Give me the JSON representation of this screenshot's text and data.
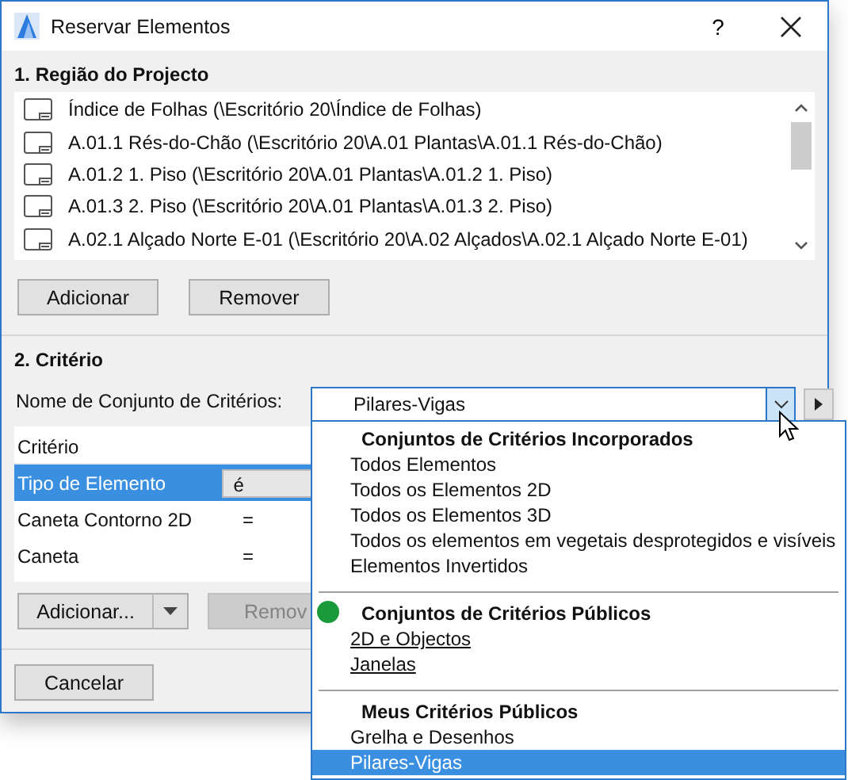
{
  "window": {
    "title": "Reservar Elementos",
    "help": "?"
  },
  "region": {
    "heading": "1. Região do Projecto",
    "items": [
      {
        "label": "Índice de Folhas (\\Escritório 20\\Índice de Folhas)"
      },
      {
        "label": "A.01.1 Rés-do-Chão (\\Escritório 20\\A.01 Plantas\\A.01.1 Rés-do-Chão)"
      },
      {
        "label": "A.01.2 1. Piso (\\Escritório 20\\A.01 Plantas\\A.01.2 1. Piso)"
      },
      {
        "label": "A.01.3 2. Piso (\\Escritório 20\\A.01 Plantas\\A.01.3 2. Piso)"
      },
      {
        "label": "A.02.1 Alçado Norte E-01 (\\Escritório 20\\A.02 Alçados\\A.02.1 Alçado Norte E-01)"
      }
    ],
    "buttons": [
      "Adicionar",
      "Remover"
    ]
  },
  "criteria": {
    "heading": "2. Critério",
    "set_label": "Nome de Conjunto de Critérios:",
    "set_value": "Pilares-Vigas",
    "column": "Critério",
    "rows": [
      {
        "name": "Tipo de Elemento",
        "operator": "é",
        "selected": true,
        "kind": "dropdown"
      },
      {
        "name": "Caneta Contorno 2D",
        "operator": "=",
        "selected": false,
        "kind": "plain"
      },
      {
        "name": "Caneta",
        "operator": "=",
        "selected": false,
        "kind": "plain"
      }
    ],
    "add_button": "Adicionar...",
    "remove_button": {
      "label": "Remov",
      "disabled": true
    }
  },
  "cancel_button": "Cancelar",
  "dropdown": {
    "groups": [
      {
        "title": "Conjuntos de Critérios Incorporados",
        "items": [
          {
            "label": "Todos Elementos",
            "underlined": false,
            "selected": false
          },
          {
            "label": "Todos os Elementos 2D",
            "underlined": false,
            "selected": false
          },
          {
            "label": "Todos os Elementos 3D",
            "underlined": false,
            "selected": false
          },
          {
            "label": "Todos os elementos em vegetais desprotegidos e visíveis",
            "underlined": false,
            "selected": false
          },
          {
            "label": "Elementos Invertidos",
            "underlined": false,
            "selected": false
          }
        ]
      },
      {
        "title": "Conjuntos de Critérios Públicos",
        "color": "#1a9a3a",
        "items": [
          {
            "label": "2D e Objectos",
            "underlined": true,
            "selected": false
          },
          {
            "label": "Janelas",
            "underlined": true,
            "selected": false
          }
        ]
      },
      {
        "title": "Meus Critérios Públicos",
        "items": [
          {
            "label": "Grelha e Desenhos",
            "underlined": false,
            "selected": false
          },
          {
            "label": "Pilares-Vigas",
            "underlined": false,
            "selected": true
          }
        ]
      }
    ]
  }
}
